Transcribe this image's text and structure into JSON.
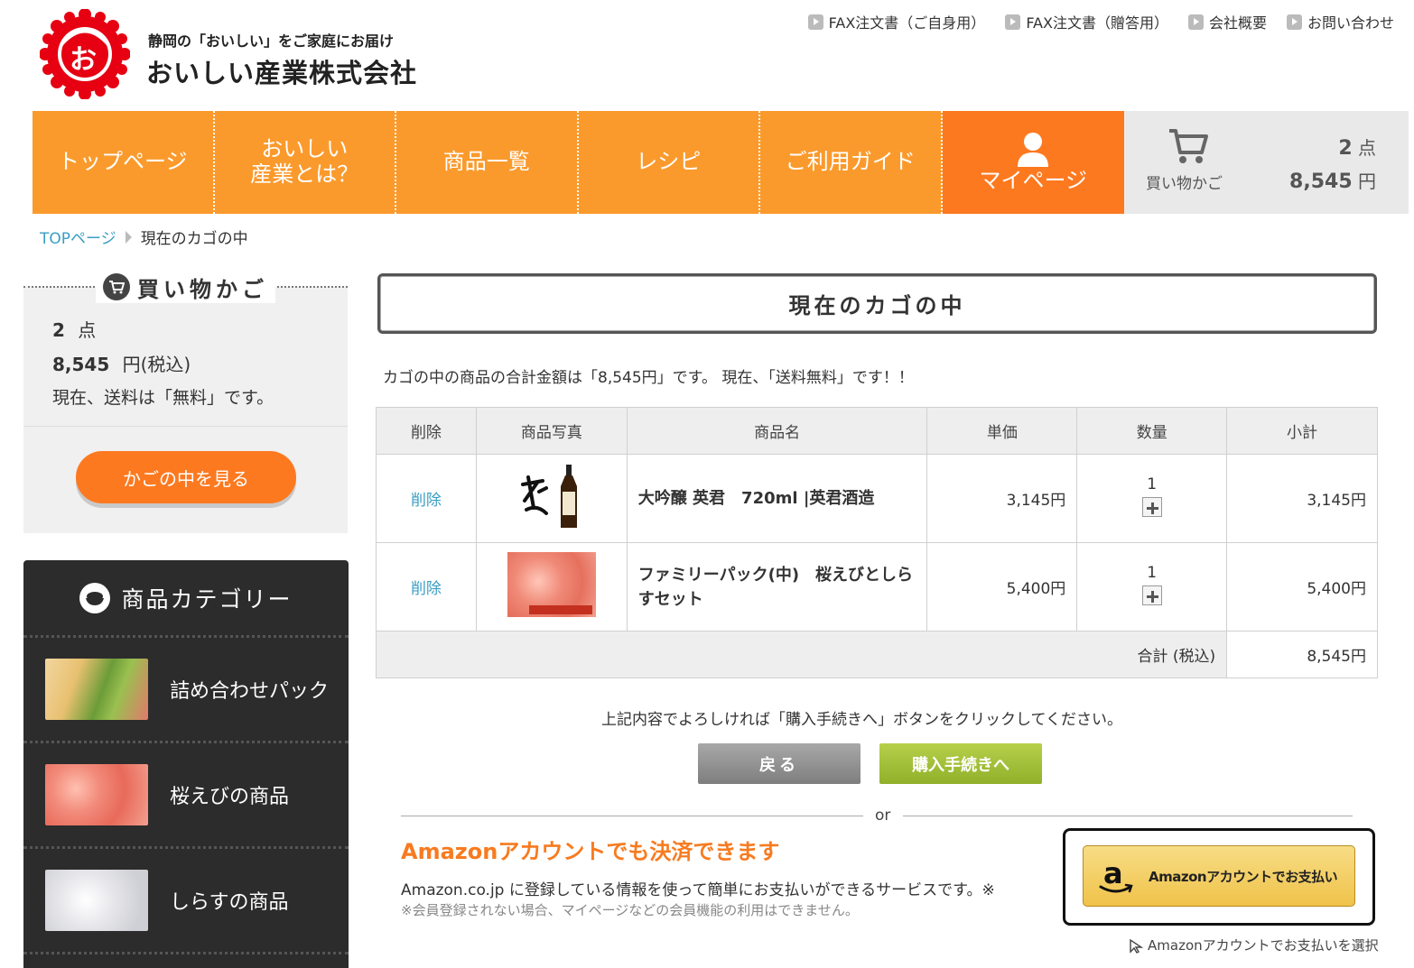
{
  "header": {
    "tagline": "静岡の「おいしい」をご家庭にお届け",
    "company_name": "おいしい産業株式会社",
    "logo_char": "お",
    "utility_links": [
      "FAX注文書（ご自身用）",
      "FAX注文書（贈答用）",
      "会社概要",
      "お問い合わせ"
    ]
  },
  "nav": {
    "items": [
      "トップページ",
      "おいしい\n産業とは？",
      "商品一覧",
      "レシピ",
      "ご利用ガイド"
    ],
    "mypage": "マイページ",
    "cart": {
      "label": "買い物かご",
      "count": "2",
      "count_unit": "点",
      "total": "8,545",
      "total_unit": "円"
    }
  },
  "breadcrumb": {
    "home": "TOPページ",
    "current": "現在のカゴの中"
  },
  "sidebar": {
    "cart_title": "買い物かご",
    "count": "2",
    "count_unit": "点",
    "total": "8,545",
    "total_unit": "円(税込)",
    "shipping": "現在、送料は「無料」です。",
    "view_cart_button": "かごの中を見る",
    "categories_title": "商品カテゴリー",
    "categories": [
      "詰め合わせパック",
      "桜えびの商品",
      "しらすの商品"
    ]
  },
  "main": {
    "title": "現在のカゴの中",
    "total_message": "カゴの中の商品の合計金額は「8,545円」です。 現在、「送料無料」です！！",
    "table": {
      "headers": [
        "削除",
        "商品写真",
        "商品名",
        "単価",
        "数量",
        "小計"
      ],
      "rows": [
        {
          "delete": "削除",
          "name": "大吟醸 英君　720ml |英君酒造",
          "price": "3,145円",
          "qty": "1",
          "subtotal": "3,145円"
        },
        {
          "delete": "削除",
          "name": "ファミリーパック(中)　桜えびとしらすセット",
          "price": "5,400円",
          "qty": "1",
          "subtotal": "5,400円"
        }
      ],
      "total_label": "合計 (税込)",
      "total_value": "8,545円"
    },
    "confirm_message": "上記内容でよろしければ「購入手続きへ」ボタンをクリックしてください。",
    "back_button": "戻る",
    "purchase_button": "購入手続きへ",
    "or_text": "or",
    "amazon": {
      "heading": "Amazonアカウントでも決済できます",
      "description": "Amazon.co.jp に登録している情報を使って簡単にお支払いができるサービスです。※",
      "note": "※会員登録されない場合、マイページなどの会員機能の利用はできません。",
      "pay_button": "Amazonアカウントでお支払い",
      "select_link": "Amazonアカウントでお支払いを選択"
    }
  },
  "colors": {
    "nav_orange": "#fb9a2c",
    "mypage_orange": "#fd7920",
    "link_blue": "#3a9ec4",
    "purchase_green": "#a3c23a",
    "amazon_heading": "#f77b20",
    "logo_red": "#e60012"
  }
}
